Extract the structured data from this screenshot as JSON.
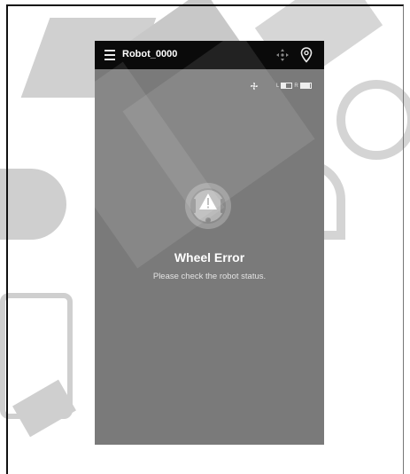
{
  "app": {
    "title": "Robot_0000"
  },
  "status": {
    "left_label": "L",
    "right_label": "R",
    "left_battery_level": 0.4,
    "right_battery_level": 0.9
  },
  "error": {
    "title": "Wheel Error",
    "message": "Please check the robot status."
  },
  "icons": {
    "menu": "hamburger-menu-icon",
    "move": "move-arrows-icon",
    "location": "location-pin-icon",
    "fan": "fan-icon",
    "robot_alert": "robot-alert-icon"
  },
  "colors": {
    "topbar": "#0a0a0a",
    "screen": "#7a7a7a",
    "text": "#ffffff"
  }
}
